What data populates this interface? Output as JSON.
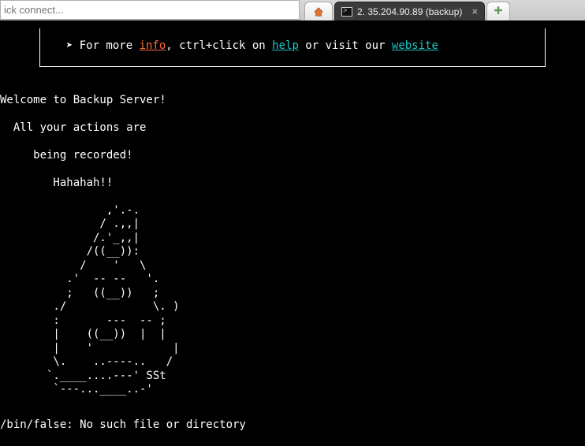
{
  "topbar": {
    "quick_connect_placeholder": "ick connect...",
    "tab_active_label": "2. 35.204.90.89 (backup)",
    "tab_close": "×",
    "tab_new": "+"
  },
  "info_box": {
    "prefix": "  ➤ For more ",
    "info_word": "info",
    "mid1": ", ctrl+click on ",
    "help_word": "help",
    "mid2": " or visit our ",
    "website_word": "website"
  },
  "motd": {
    "line1": "Welcome to Backup Server!",
    "line2": "  All your actions are",
    "line3": "     being recorded!",
    "line4": "        Hahahah!!"
  },
  "ascii_art": "                ,'.-.\n               / .,,|\n              /.'_,,|\n             /((__)):\n            /    '   \\\n          .'  -- --   '.\n          ;   ((__))   ;\n        ./             \\. )\n        :       ---  -- ;\n        |    ((__))  |  |\n        |    '            |\n        \\.    ..----..   /\n       `.____....---' SSt\n        `---...____..-'",
  "error": "/bin/false: No such file or directory"
}
